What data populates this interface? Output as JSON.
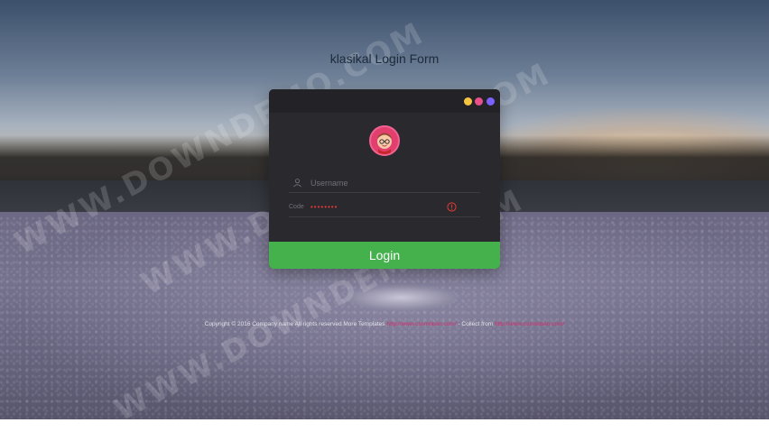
{
  "page": {
    "title": "klasikal Login Form"
  },
  "window_controls": {
    "dots": [
      {
        "name": "minimize",
        "color": "#f5c542"
      },
      {
        "name": "zoom",
        "color": "#e8508c"
      },
      {
        "name": "close",
        "color": "#7b61ff"
      }
    ]
  },
  "login": {
    "username_placeholder": "Username",
    "password_label": "Code",
    "password_value": "••••••••",
    "submit_label": "Login"
  },
  "footer": {
    "copyright": "Copyright © 2016 Company name All rights reserved More Templates",
    "link1": "http://www.cssmoban.com/",
    "collect": "- Collect from",
    "link2": "http://www.cssmoban.com/"
  },
  "watermark": {
    "text": "WWW.DOWNDEMO.COM"
  },
  "colors": {
    "card_bg": "#2a2a2e",
    "button_green": "#44b14c",
    "avatar_pink": "#e23f6e",
    "warning_red": "#e53935"
  }
}
